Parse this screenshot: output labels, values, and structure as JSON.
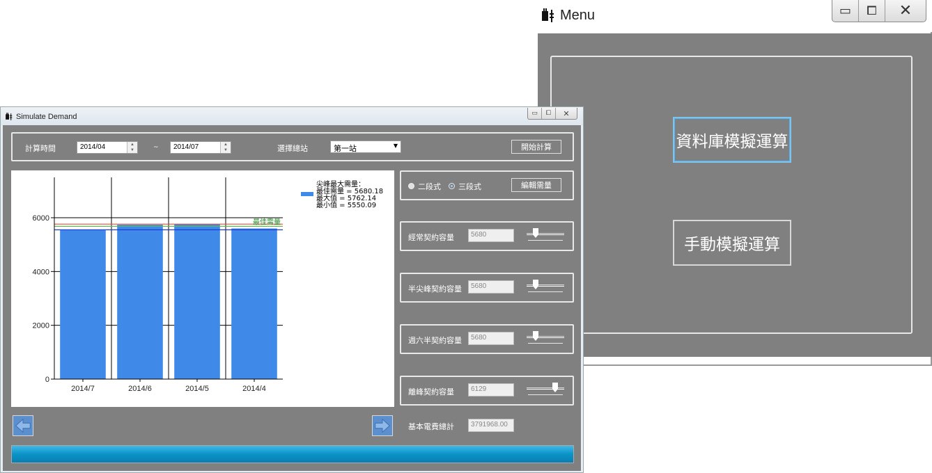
{
  "menu_window": {
    "title": "Menu",
    "buttons": {
      "database_sim": "資料庫模擬運算",
      "manual_sim": "手動模擬運算"
    },
    "controls": {
      "minimize": "▭",
      "maximize": "⧠",
      "close": "✕"
    }
  },
  "sim_window": {
    "title": "Simulate Demand",
    "controls": {
      "minimize": "▭",
      "maximize": "⧠",
      "close": "✕"
    },
    "toolbar": {
      "period_label": "計算時間",
      "start": "2014/04",
      "tilde": "~",
      "end": "2014/07",
      "station_label": "選擇總站",
      "station_value": "第一站",
      "start_button": "開始計算"
    },
    "mode": {
      "option_two": "二段式",
      "option_three": "三段式",
      "selected": "三段式",
      "edit_button": "編輯需量"
    },
    "contracts": [
      {
        "label": "經常契約容量",
        "value": "5680",
        "slider_level": 0.2
      },
      {
        "label": "半尖峰契約容量",
        "value": "5680",
        "slider_level": 0.2
      },
      {
        "label": "週六半契約容量",
        "value": "5680",
        "slider_level": 0.2
      },
      {
        "label": "離峰契約容量",
        "value": "6129",
        "slider_level": 0.8
      }
    ],
    "total": {
      "label": "基本電費總計",
      "value": "3791968.00"
    },
    "colors": {
      "bar": "#3f8ae8",
      "optimal_line": "#5cb85c",
      "max_line": "#e74c3c",
      "min_line": "#1f3bd1",
      "progress": "#0a93c8"
    }
  },
  "chart_data": {
    "type": "bar",
    "categories": [
      "2014/7",
      "2014/6",
      "2014/5",
      "2014/4"
    ],
    "values": [
      5550.09,
      5740,
      5762.14,
      5600
    ],
    "ylim": [
      0,
      7500
    ],
    "yticks": [
      0,
      2000,
      4000,
      6000
    ],
    "legend_title": "尖峰最大需量：",
    "legend_lines": [
      "最佳需量 = 5680.18",
      "最大值 = 5762.14",
      "最小值 = 5550.09"
    ],
    "reference_lines": [
      {
        "name": "最佳需量",
        "value": 5680.18,
        "color": "#5cb85c"
      },
      {
        "name": "最大值",
        "value": 5762.14,
        "color": "#e74c3c"
      },
      {
        "name": "最小值",
        "value": 5550.09,
        "color": "#1f3bd1"
      }
    ],
    "optimal_label": "最佳需量",
    "grid": true,
    "legend_position": "top-right"
  }
}
